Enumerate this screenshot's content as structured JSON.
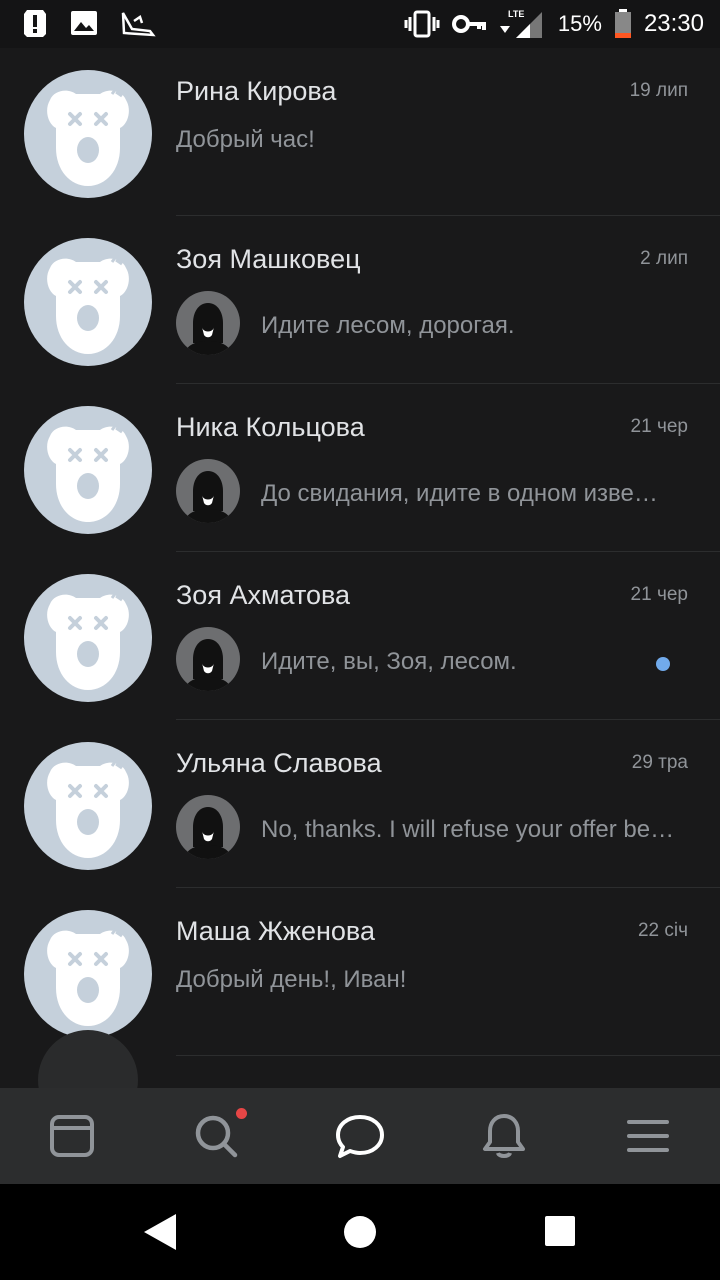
{
  "status_bar": {
    "battery_percent": "15%",
    "time": "23:30",
    "network": "LTE",
    "icons": [
      "alert-icon",
      "image-icon",
      "app-icon",
      "vibrate-icon",
      "vpn-key-icon",
      "signal-icon",
      "battery-icon"
    ]
  },
  "chats": [
    {
      "name": "Рина Кирова",
      "date": "19 лип",
      "preview": "Добрый час!",
      "has_sender_avatar": false,
      "unread": false
    },
    {
      "name": "Зоя Машковец",
      "date": "2 лип",
      "preview": "Идите лесом, дорогая.",
      "has_sender_avatar": true,
      "unread": false
    },
    {
      "name": "Ника Кольцова",
      "date": "21 чер",
      "preview": "До свидания, идите в одном изве…",
      "has_sender_avatar": true,
      "unread": false
    },
    {
      "name": "Зоя Ахматова",
      "date": "21 чер",
      "preview": "Идите, вы, Зоя, лесом.",
      "has_sender_avatar": true,
      "unread": true
    },
    {
      "name": "Ульяна Славова",
      "date": "29 тра",
      "preview": "No, thanks. I will refuse your offer be…",
      "has_sender_avatar": true,
      "unread": false
    },
    {
      "name": "Маша Жженова",
      "date": "22 січ",
      "preview": "Добрый день!, Иван!",
      "has_sender_avatar": false,
      "unread": false
    }
  ],
  "tab_bar": {
    "tabs": [
      "news-icon",
      "search-icon",
      "messages-icon",
      "notifications-icon",
      "menu-icon"
    ],
    "active": "messages-icon",
    "search_has_badge": true
  },
  "colors": {
    "background": "#19191a",
    "tab_bar": "#2c2d2e",
    "accent": "#ffffff",
    "unread": "#71aaeb",
    "badge": "#e64646",
    "avatar_placeholder": "#c5d0db"
  }
}
